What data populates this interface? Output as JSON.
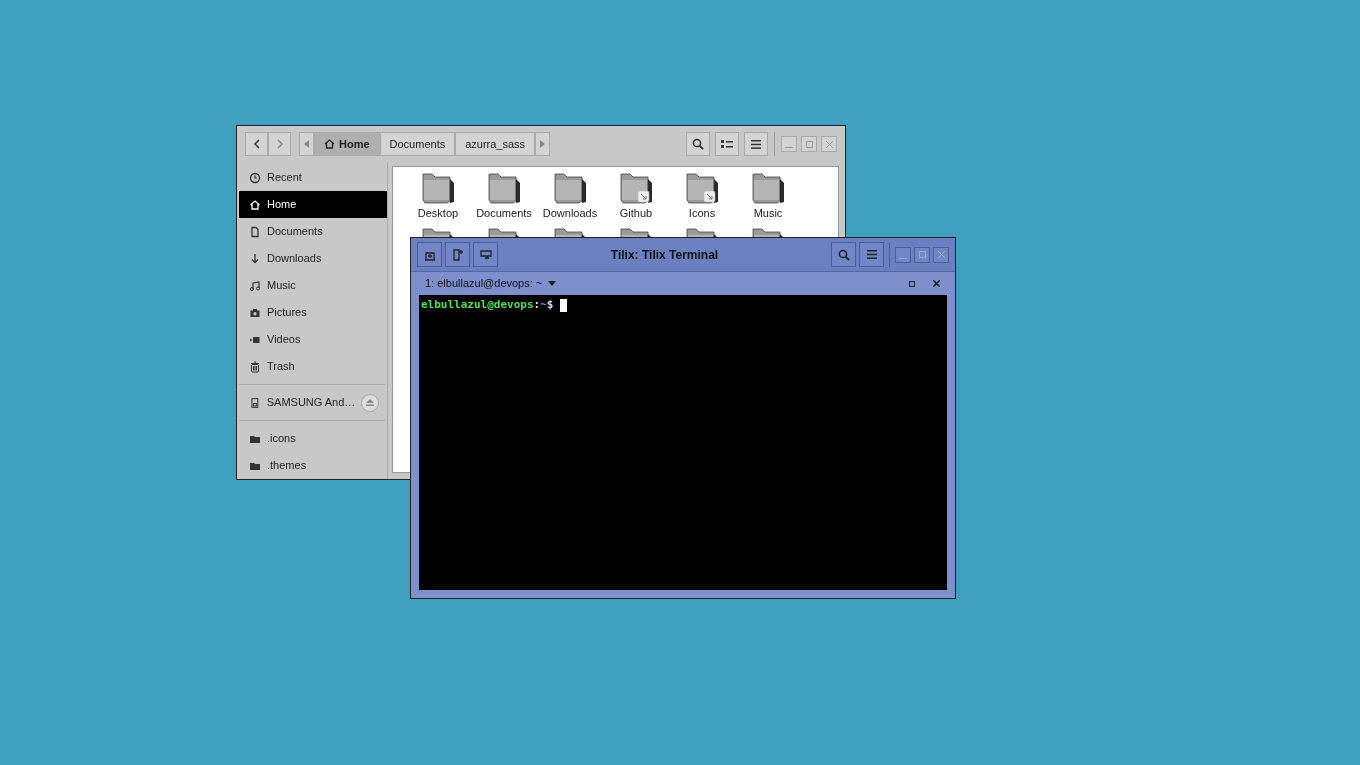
{
  "file_manager": {
    "path": [
      {
        "label": "Home",
        "selected": true
      },
      {
        "label": "Documents",
        "selected": false
      },
      {
        "label": "azurra_sass",
        "selected": false
      }
    ],
    "sidebar": [
      {
        "items": [
          {
            "label": "Recent",
            "kind": "recent",
            "selected": false
          },
          {
            "label": "Home",
            "kind": "home",
            "selected": true
          },
          {
            "label": "Documents",
            "kind": "documents",
            "selected": false
          },
          {
            "label": "Downloads",
            "kind": "downloads",
            "selected": false
          },
          {
            "label": "Music",
            "kind": "music",
            "selected": false
          },
          {
            "label": "Pictures",
            "kind": "pictures",
            "selected": false
          },
          {
            "label": "Videos",
            "kind": "videos",
            "selected": false
          },
          {
            "label": "Trash",
            "kind": "trash",
            "selected": false
          }
        ]
      },
      {
        "items": [
          {
            "label": "SAMSUNG And…",
            "kind": "drive",
            "selected": false,
            "eject": true
          }
        ]
      },
      {
        "items": [
          {
            "label": ".icons",
            "kind": "folder",
            "selected": false
          },
          {
            "label": ".themes",
            "kind": "folder",
            "selected": false
          }
        ]
      }
    ],
    "folders": [
      {
        "label": "Desktop",
        "kind": "folder"
      },
      {
        "label": "Documents",
        "kind": "folder"
      },
      {
        "label": "Downloads",
        "kind": "folder"
      },
      {
        "label": "Github",
        "kind": "link"
      },
      {
        "label": "Icons",
        "kind": "link"
      },
      {
        "label": "Music",
        "kind": "folder"
      }
    ],
    "folders_partial": [
      {
        "kind": "folder"
      },
      {
        "kind": "folder"
      },
      {
        "kind": "folder"
      },
      {
        "kind": "folder"
      },
      {
        "kind": "folder"
      },
      {
        "kind": "folder"
      }
    ]
  },
  "terminal": {
    "title": "Tilix: Tilix Terminal",
    "tab": "1: elbullazul@devops: ~",
    "prompt_user": "elbullazul@devops",
    "prompt_sep": ":",
    "prompt_dir": "~",
    "prompt_symbol": "$"
  }
}
